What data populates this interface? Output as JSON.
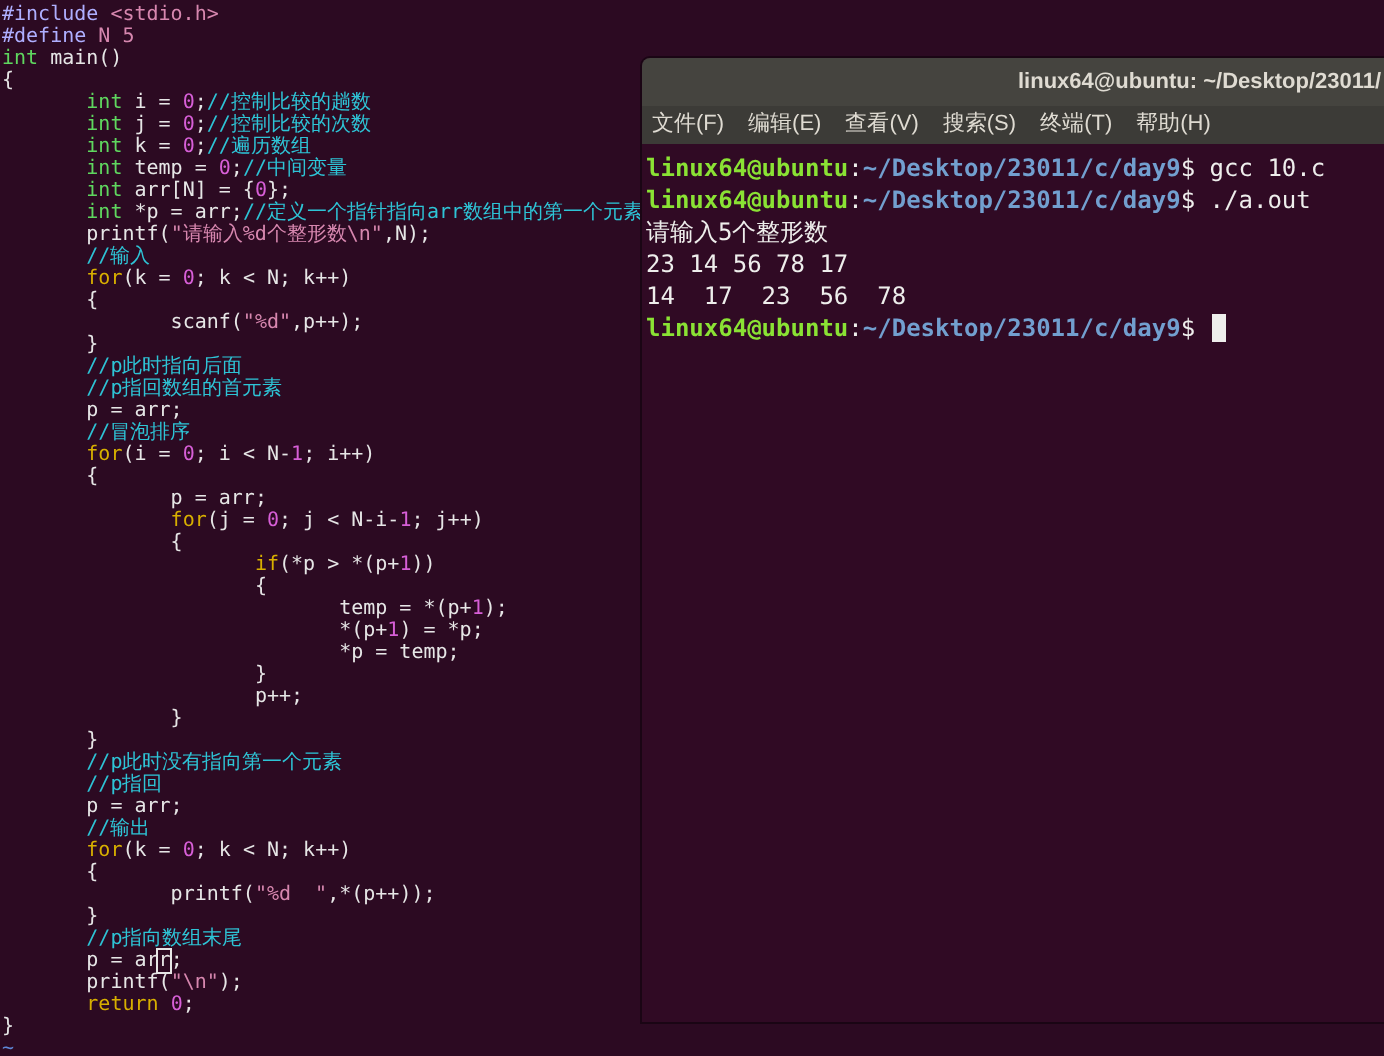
{
  "editor": {
    "lines": [
      {
        "tokens": [
          {
            "kind": "preproc",
            "text": "#include "
          },
          {
            "kind": "string",
            "text": "<stdio.h>"
          }
        ]
      },
      {
        "tokens": [
          {
            "kind": "preproc",
            "text": "#define "
          },
          {
            "kind": "string",
            "text": "N 5"
          }
        ]
      },
      {
        "tokens": [
          {
            "kind": "type",
            "text": "int"
          },
          {
            "kind": "plain",
            "text": " main()"
          }
        ]
      },
      {
        "tokens": [
          {
            "kind": "plain",
            "text": "{"
          }
        ]
      },
      {
        "tokens": [
          {
            "kind": "type",
            "text": "\tint"
          },
          {
            "kind": "plain",
            "text": " i = "
          },
          {
            "kind": "number",
            "text": "0"
          },
          {
            "kind": "plain",
            "text": ";"
          },
          {
            "kind": "comment",
            "text": "//控制比较的趟数"
          }
        ]
      },
      {
        "tokens": [
          {
            "kind": "type",
            "text": "\tint"
          },
          {
            "kind": "plain",
            "text": " j = "
          },
          {
            "kind": "number",
            "text": "0"
          },
          {
            "kind": "plain",
            "text": ";"
          },
          {
            "kind": "comment",
            "text": "//控制比较的次数"
          }
        ]
      },
      {
        "tokens": [
          {
            "kind": "type",
            "text": "\tint"
          },
          {
            "kind": "plain",
            "text": " k = "
          },
          {
            "kind": "number",
            "text": "0"
          },
          {
            "kind": "plain",
            "text": ";"
          },
          {
            "kind": "comment",
            "text": "//遍历数组"
          }
        ]
      },
      {
        "tokens": [
          {
            "kind": "type",
            "text": "\tint"
          },
          {
            "kind": "plain",
            "text": " temp = "
          },
          {
            "kind": "number",
            "text": "0"
          },
          {
            "kind": "plain",
            "text": ";"
          },
          {
            "kind": "comment",
            "text": "//中间变量"
          }
        ]
      },
      {
        "tokens": [
          {
            "kind": "type",
            "text": "\tint"
          },
          {
            "kind": "plain",
            "text": " arr[N] = {"
          },
          {
            "kind": "number",
            "text": "0"
          },
          {
            "kind": "plain",
            "text": "};"
          }
        ]
      },
      {
        "tokens": [
          {
            "kind": "type",
            "text": "\tint"
          },
          {
            "kind": "plain",
            "text": " *p = arr;"
          },
          {
            "kind": "comment",
            "text": "//定义一个指针指向arr数组中的第一个元素"
          }
        ]
      },
      {
        "tokens": [
          {
            "kind": "plain",
            "text": "\tprintf("
          },
          {
            "kind": "string",
            "text": "\"请输入%d个整形数\\n\""
          },
          {
            "kind": "plain",
            "text": ",N);"
          }
        ]
      },
      {
        "tokens": [
          {
            "kind": "comment",
            "text": "\t//输入"
          }
        ]
      },
      {
        "tokens": [
          {
            "kind": "keyword",
            "text": "\tfor"
          },
          {
            "kind": "plain",
            "text": "(k = "
          },
          {
            "kind": "number",
            "text": "0"
          },
          {
            "kind": "plain",
            "text": "; k < N; k++)"
          }
        ]
      },
      {
        "tokens": [
          {
            "kind": "plain",
            "text": "\t{"
          }
        ]
      },
      {
        "tokens": [
          {
            "kind": "plain",
            "text": "\t\tscanf("
          },
          {
            "kind": "string",
            "text": "\"%d\""
          },
          {
            "kind": "plain",
            "text": ",p++);"
          }
        ]
      },
      {
        "tokens": [
          {
            "kind": "plain",
            "text": "\t}"
          }
        ]
      },
      {
        "tokens": [
          {
            "kind": "comment",
            "text": "\t//p此时指向后面"
          }
        ]
      },
      {
        "tokens": [
          {
            "kind": "comment",
            "text": "\t//p指回数组的首元素"
          }
        ]
      },
      {
        "tokens": [
          {
            "kind": "plain",
            "text": "\tp = arr;"
          }
        ]
      },
      {
        "tokens": [
          {
            "kind": "comment",
            "text": "\t//冒泡排序"
          }
        ]
      },
      {
        "tokens": [
          {
            "kind": "keyword",
            "text": "\tfor"
          },
          {
            "kind": "plain",
            "text": "(i = "
          },
          {
            "kind": "number",
            "text": "0"
          },
          {
            "kind": "plain",
            "text": "; i < N-"
          },
          {
            "kind": "number",
            "text": "1"
          },
          {
            "kind": "plain",
            "text": "; i++)"
          }
        ]
      },
      {
        "tokens": [
          {
            "kind": "plain",
            "text": "\t{"
          }
        ]
      },
      {
        "tokens": [
          {
            "kind": "plain",
            "text": "\t\tp = arr;"
          }
        ]
      },
      {
        "tokens": [
          {
            "kind": "keyword",
            "text": "\t\tfor"
          },
          {
            "kind": "plain",
            "text": "(j = "
          },
          {
            "kind": "number",
            "text": "0"
          },
          {
            "kind": "plain",
            "text": "; j < N-i-"
          },
          {
            "kind": "number",
            "text": "1"
          },
          {
            "kind": "plain",
            "text": "; j++)"
          }
        ]
      },
      {
        "tokens": [
          {
            "kind": "plain",
            "text": "\t\t{"
          }
        ]
      },
      {
        "tokens": [
          {
            "kind": "keyword",
            "text": "\t\t\tif"
          },
          {
            "kind": "plain",
            "text": "(*p > *(p+"
          },
          {
            "kind": "number",
            "text": "1"
          },
          {
            "kind": "plain",
            "text": "))"
          }
        ]
      },
      {
        "tokens": [
          {
            "kind": "plain",
            "text": "\t\t\t{"
          }
        ]
      },
      {
        "tokens": [
          {
            "kind": "plain",
            "text": "\t\t\t\ttemp = *(p+"
          },
          {
            "kind": "number",
            "text": "1"
          },
          {
            "kind": "plain",
            "text": ");"
          }
        ]
      },
      {
        "tokens": [
          {
            "kind": "plain",
            "text": "\t\t\t\t*(p+"
          },
          {
            "kind": "number",
            "text": "1"
          },
          {
            "kind": "plain",
            "text": ") = *p;"
          }
        ]
      },
      {
        "tokens": [
          {
            "kind": "plain",
            "text": "\t\t\t\t*p = temp;"
          }
        ]
      },
      {
        "tokens": [
          {
            "kind": "plain",
            "text": "\t\t\t}"
          }
        ]
      },
      {
        "tokens": [
          {
            "kind": "plain",
            "text": "\t\t\tp++;"
          }
        ]
      },
      {
        "tokens": [
          {
            "kind": "plain",
            "text": "\t\t}"
          }
        ]
      },
      {
        "tokens": [
          {
            "kind": "plain",
            "text": "\t}"
          }
        ]
      },
      {
        "tokens": [
          {
            "kind": "comment",
            "text": "\t//p此时没有指向第一个元素"
          }
        ]
      },
      {
        "tokens": [
          {
            "kind": "comment",
            "text": "\t//p指回"
          }
        ]
      },
      {
        "tokens": [
          {
            "kind": "plain",
            "text": "\tp = arr;"
          }
        ]
      },
      {
        "tokens": [
          {
            "kind": "comment",
            "text": "\t//输出"
          }
        ]
      },
      {
        "tokens": [
          {
            "kind": "keyword",
            "text": "\tfor"
          },
          {
            "kind": "plain",
            "text": "(k = "
          },
          {
            "kind": "number",
            "text": "0"
          },
          {
            "kind": "plain",
            "text": "; k < N; k++)"
          }
        ]
      },
      {
        "tokens": [
          {
            "kind": "plain",
            "text": "\t{"
          }
        ]
      },
      {
        "tokens": [
          {
            "kind": "plain",
            "text": "\t\tprintf("
          },
          {
            "kind": "string",
            "text": "\"%d  \""
          },
          {
            "kind": "plain",
            "text": ",*(p++));"
          }
        ]
      },
      {
        "tokens": [
          {
            "kind": "plain",
            "text": "\t}"
          }
        ]
      },
      {
        "tokens": [
          {
            "kind": "comment",
            "text": "\t//p指向数组末尾"
          }
        ]
      },
      {
        "tokens": [
          {
            "kind": "plain",
            "text": "\tp = ar"
          },
          {
            "kind": "cursor",
            "text": "r"
          },
          {
            "kind": "plain",
            "text": ";"
          }
        ]
      },
      {
        "tokens": [
          {
            "kind": "plain",
            "text": "\tprintf("
          },
          {
            "kind": "string",
            "text": "\"\\n\""
          },
          {
            "kind": "plain",
            "text": ");"
          }
        ]
      },
      {
        "tokens": [
          {
            "kind": "keyword",
            "text": "\treturn "
          },
          {
            "kind": "number",
            "text": "0"
          },
          {
            "kind": "plain",
            "text": ";"
          }
        ]
      },
      {
        "tokens": [
          {
            "kind": "plain",
            "text": "}"
          }
        ]
      },
      {
        "tokens": [
          {
            "kind": "tilde",
            "text": "~"
          }
        ]
      }
    ]
  },
  "terminal": {
    "title": "linux64@ubuntu: ~/Desktop/23011/",
    "menu": [
      "文件(F)",
      "编辑(E)",
      "查看(V)",
      "搜索(S)",
      "终端(T)",
      "帮助(H)"
    ],
    "lines": [
      {
        "kind": "prompt",
        "user": "linux64@ubuntu",
        "sep": ":",
        "path": "~/Desktop/23011/c/day9",
        "mark": "$",
        "command": "gcc 10.c"
      },
      {
        "kind": "prompt",
        "user": "linux64@ubuntu",
        "sep": ":",
        "path": "~/Desktop/23011/c/day9",
        "mark": "$",
        "command": "./a.out"
      },
      {
        "kind": "output",
        "text": "请输入5个整形数"
      },
      {
        "kind": "output",
        "text": "23 14 56 78 17"
      },
      {
        "kind": "output",
        "text": "14  17  23  56  78"
      },
      {
        "kind": "prompt",
        "user": "linux64@ubuntu",
        "sep": ":",
        "path": "~/Desktop/23011/c/day9",
        "mark": "$",
        "cursor": true
      }
    ]
  }
}
